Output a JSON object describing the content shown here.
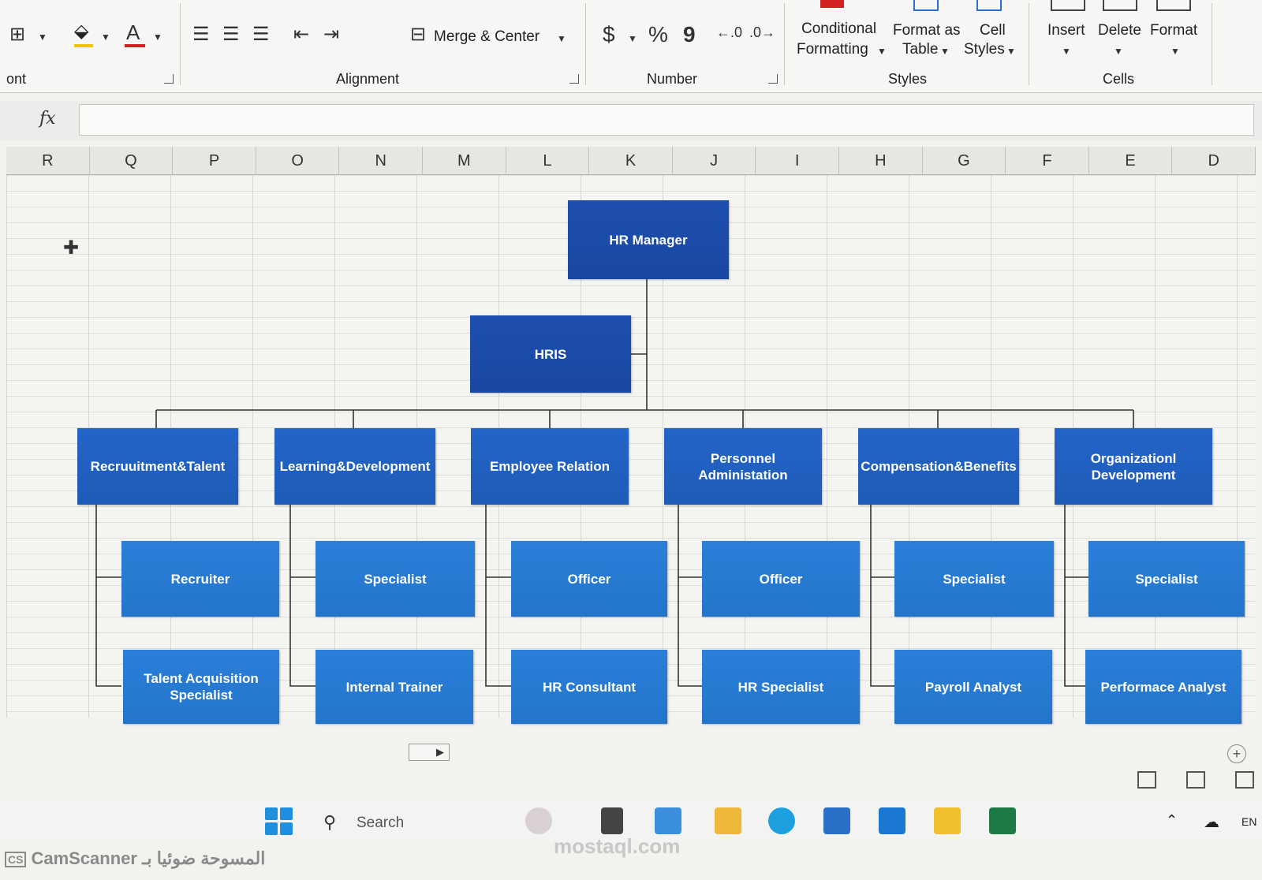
{
  "ribbon": {
    "font_group_label": "ont",
    "alignment_label": "Alignment",
    "merge_center_label": "Merge & Center",
    "number_label": "Number",
    "currency_symbol": "$",
    "percent_symbol": "%",
    "comma_symbol": "9",
    "styles_label": "Styles",
    "conditional_formatting": [
      "Conditional",
      "Formatting"
    ],
    "format_as_table": [
      "Format as",
      "Table"
    ],
    "cell_styles": [
      "Cell",
      "Styles"
    ],
    "cells_label": "Cells",
    "insert_label": "Insert",
    "delete_label": "Delete",
    "format_label": "Format",
    "font_color_letter": "A"
  },
  "formula_bar": {
    "fx": "fx",
    "value": ""
  },
  "columns": [
    "R",
    "Q",
    "P",
    "O",
    "N",
    "M",
    "L",
    "K",
    "J",
    "I",
    "H",
    "G",
    "F",
    "E",
    "D"
  ],
  "org_chart": {
    "manager": "HR Manager",
    "assistant": "HRIS",
    "departments": [
      {
        "name": "Recruuitment&Talent",
        "roles": [
          "Recruiter",
          "Talent Acquisition Specialist"
        ]
      },
      {
        "name": "Learning&Development",
        "roles": [
          "Specialist",
          "Internal Trainer"
        ]
      },
      {
        "name": "Employee Relation",
        "roles": [
          "Officer",
          "HR Consultant"
        ]
      },
      {
        "name": "Personnel Administation",
        "roles": [
          "Officer",
          "HR Specialist"
        ]
      },
      {
        "name": "Compensation&Benefits",
        "roles": [
          "Specialist",
          "Payroll Analyst"
        ]
      },
      {
        "name": "Organizationl Development",
        "roles": [
          "Specialist",
          "Performace Analyst"
        ]
      }
    ]
  },
  "taskbar": {
    "search_placeholder": "Search",
    "language": "EN"
  },
  "watermark": {
    "scanner": "CamScanner المسوحة ضوئيا بـ",
    "site": "mostaql.com"
  },
  "colors": {
    "top_box": "#1d4fb0",
    "dept_box": "#2365c8",
    "role_box": "#2a7fd8",
    "connector": "#333333"
  }
}
